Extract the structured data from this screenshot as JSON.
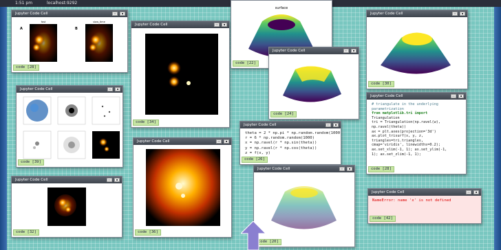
{
  "topbar": {
    "time": "1:51 pm",
    "url": "localhost:9292"
  },
  "window_title": "Jupyter Code Cell",
  "surface_title": "surface",
  "cells": {
    "c28": {
      "tag": "code [28]",
      "panel_a": "A",
      "panel_b": "B",
      "title_a": "fast",
      "title_b": "slow_time"
    },
    "c39": {
      "tag": "code [39]"
    },
    "c32": {
      "tag": "code [32]"
    },
    "c34": {
      "tag": "code [34]"
    },
    "c36": {
      "tag": "code [36]"
    },
    "c22": {
      "tag": "code [22]"
    },
    "c24": {
      "tag": "code [24]"
    },
    "c30": {
      "tag": "code [30]"
    },
    "c26": {
      "tag": "code [26]",
      "lines": [
        "theta = 2 * np.pi * np.random.random(1000)",
        "r = 6 * np.random.random(1000)",
        "x = np.ravel(r * np.sin(theta))",
        "y = np.ravel(r * np.cos(theta))",
        "z = f(x, y)"
      ]
    },
    "c28b": {
      "tag": "code [28]",
      "lines": [
        "# triangulate in the underlying",
        "parametrization",
        "from matplotlib.tri import",
        "Triangulation",
        "tri = Triangulation(np.ravel(w),",
        "np.ravel(theta))",
        "",
        "ax = plt.axes(projection='3d')",
        "ax.plot_trisurf(x, y, z,",
        "triangles=tri.triangles,",
        "cmap='viridis', linewidths=0.2);",
        "",
        "ax.set_xlim(-1, 1); ax.set_ylim(-1,",
        "1); ax.set_zlim(-1, 1);"
      ]
    },
    "c42": {
      "tag": "code [42]",
      "error": "NameError: name 'x' is not defined"
    },
    "c20": {
      "tag": "code [20]"
    }
  },
  "colors": {
    "accent_arrow": "#8a7fd0",
    "error_bg": "#fde4e4",
    "code_tag": "#c7e6a3"
  }
}
